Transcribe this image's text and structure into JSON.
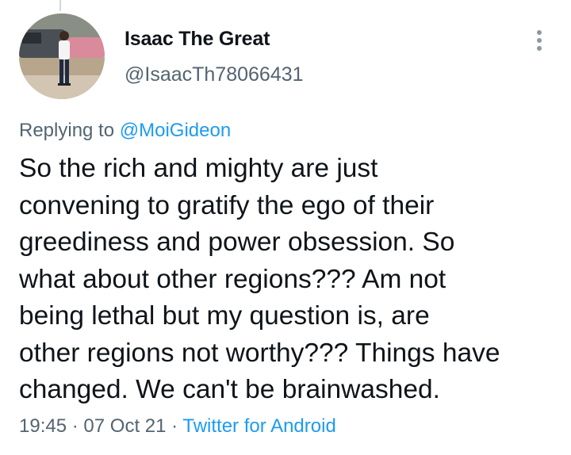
{
  "tweet": {
    "author": {
      "display_name": "Isaac The Great",
      "handle": "@IsaacTh78066431"
    },
    "replying_to": {
      "prefix": "Replying to",
      "mention": "@MoiGideon"
    },
    "text_lines": [
      "So the rich and mighty are just",
      "convening to gratify the ego of their",
      "greediness and power obsession. So",
      "what about other regions??? Am not",
      "being lethal but my question is, are",
      "other regions not worthy??? Things have",
      "changed. We can't be brainwashed."
    ],
    "time": "19:45",
    "separator": "·",
    "date": "07 Oct 21",
    "source": "Twitter for Android"
  },
  "icons": {
    "more": "more-vertical-icon",
    "avatar": "profile-photo"
  },
  "colors": {
    "text": "#0f1419",
    "secondary": "#536471",
    "link": "#1d9bf0"
  }
}
